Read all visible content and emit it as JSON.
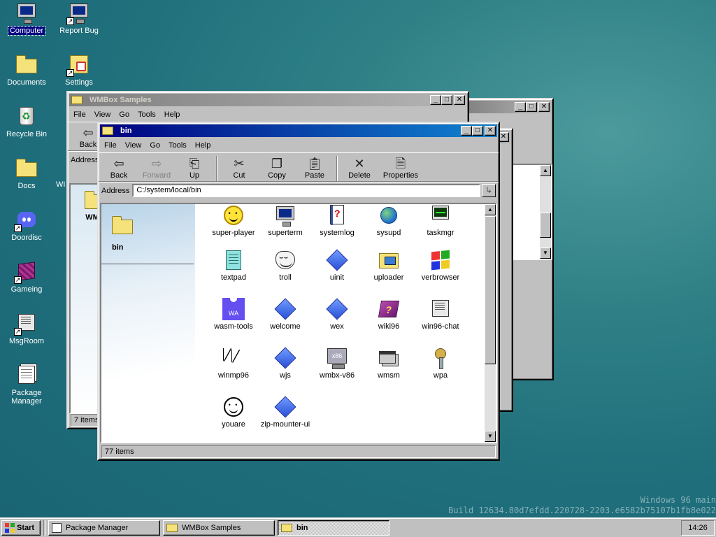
{
  "desktop": {
    "icons": [
      {
        "label": "Computer",
        "icon": "computer-icon"
      },
      {
        "label": "Report Bug",
        "icon": "report-bug-icon"
      },
      {
        "label": "Documents",
        "icon": "documents-folder-icon"
      },
      {
        "label": "Settings",
        "icon": "settings-icon"
      },
      {
        "label": "Recycle Bin",
        "icon": "recycle-bin-icon"
      },
      {
        "label": "Docs",
        "icon": "docs-folder-icon"
      },
      {
        "label": "Doordisc",
        "icon": "discord-icon"
      },
      {
        "label": "Gameing",
        "icon": "cube-icon"
      },
      {
        "label": "MsgRoom",
        "icon": "msgroom-icon"
      },
      {
        "label": "Package Manager",
        "icon": "package-manager-icon"
      }
    ],
    "watermark_line1": "Windows 96 main",
    "watermark_line2": "Build 12634.80d7efdd.220728-2203.e6582b75107b1fb8e022"
  },
  "back_window": {
    "title": "WMBox Samples",
    "menu": [
      "File",
      "View",
      "Go",
      "Tools",
      "Help"
    ],
    "back_label": "Back",
    "address_label": "Address",
    "folder_label": "WMB",
    "side_label": "WI",
    "status": "7 items"
  },
  "bin_window": {
    "title": "bin",
    "menu": [
      "File",
      "View",
      "Go",
      "Tools",
      "Help"
    ],
    "toolbar": {
      "back": "Back",
      "forward": "Forward",
      "up": "Up",
      "cut": "Cut",
      "copy": "Copy",
      "paste": "Paste",
      "delete": "Delete",
      "properties": "Properties"
    },
    "address_label": "Address",
    "address_value": "C:/system/local/bin",
    "side_folder": "bin",
    "items": [
      {
        "label": "super-player",
        "icon": "smiley-yellow-icon"
      },
      {
        "label": "superterm",
        "icon": "terminal-icon"
      },
      {
        "label": "systemlog",
        "icon": "systemlog-icon"
      },
      {
        "label": "sysupd",
        "icon": "globe-icon"
      },
      {
        "label": "taskmgr",
        "icon": "task-manager-icon"
      },
      {
        "label": "textpad",
        "icon": "textpad-icon"
      },
      {
        "label": "troll",
        "icon": "trollface-icon"
      },
      {
        "label": "uinit",
        "icon": "diamond-icon"
      },
      {
        "label": "uploader",
        "icon": "uploader-icon"
      },
      {
        "label": "verbrowser",
        "icon": "windows-logo-icon"
      },
      {
        "label": "wasm-tools",
        "icon": "wasm-icon",
        "badge": "WA"
      },
      {
        "label": "welcome",
        "icon": "diamond-icon"
      },
      {
        "label": "wex",
        "icon": "diamond-icon"
      },
      {
        "label": "wiki96",
        "icon": "book-icon"
      },
      {
        "label": "win96-chat",
        "icon": "chat-icon"
      },
      {
        "label": "winmp96",
        "icon": "cursor-icon"
      },
      {
        "label": "wjs",
        "icon": "diamond-icon"
      },
      {
        "label": "wmbx-v86",
        "icon": "x86-icon",
        "badge": "x86"
      },
      {
        "label": "wmsm",
        "icon": "window-manager-icon"
      },
      {
        "label": "wpa",
        "icon": "keys-icon"
      },
      {
        "label": "youare",
        "icon": "smiley-icon"
      },
      {
        "label": "zip-mounter-ui",
        "icon": "diamond-icon"
      }
    ],
    "status": "77 items"
  },
  "taskbar": {
    "start_label": "Start",
    "tasks": [
      {
        "label": "Package Manager",
        "active": false
      },
      {
        "label": "WMBox Samples",
        "active": false
      },
      {
        "label": "bin",
        "active": true
      }
    ],
    "clock": "14:26"
  },
  "colors": {
    "desktop": "#1f6f7c",
    "active_title_start": "#000080",
    "active_title_end": "#1084d0"
  }
}
